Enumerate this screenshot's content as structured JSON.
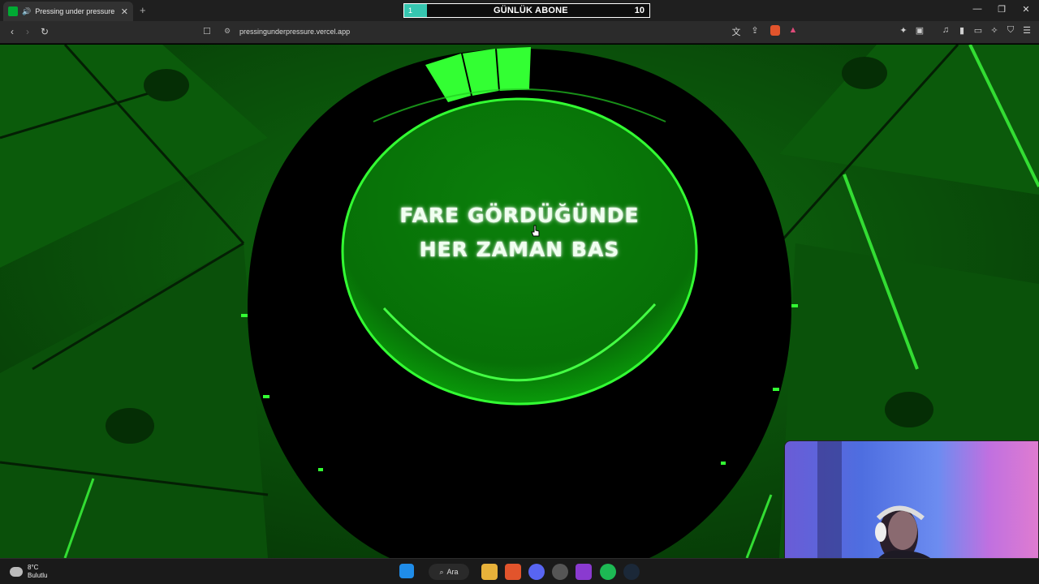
{
  "browser": {
    "tab_title": "Pressing under pressure",
    "url": "pressingunderpressure.vercel.app"
  },
  "subscriber_widget": {
    "current": "1",
    "label": "GÜNLÜK ABONE",
    "goal": "10"
  },
  "game": {
    "instruction_line1": "FARE GÖRDÜĞÜNDE",
    "instruction_line2": "HER ZAMAN BAS",
    "progress_segments_lit": 3,
    "accent_color": "#33ff33"
  },
  "taskbar": {
    "weather_temp": "8°C",
    "weather_desc": "Bulutlu",
    "search_label": "Ara"
  }
}
